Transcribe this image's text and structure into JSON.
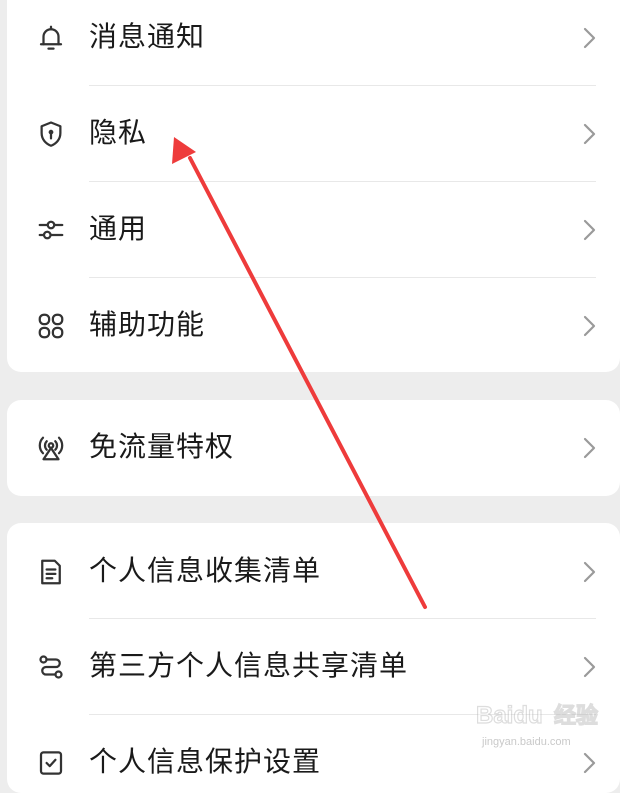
{
  "groups": [
    {
      "items": [
        {
          "label": "消息通知",
          "icon": "bell-icon"
        },
        {
          "label": "隐私",
          "icon": "shield-lock-icon"
        },
        {
          "label": "通用",
          "icon": "sliders-icon"
        },
        {
          "label": "辅助功能",
          "icon": "grid-icon"
        }
      ]
    },
    {
      "items": [
        {
          "label": "免流量特权",
          "icon": "signal-tower-icon"
        }
      ]
    },
    {
      "items": [
        {
          "label": "个人信息收集清单",
          "icon": "document-list-icon"
        },
        {
          "label": "第三方个人信息共享清单",
          "icon": "share-flow-icon"
        },
        {
          "label": "个人信息保护设置",
          "icon": "check-shield-icon"
        }
      ]
    }
  ],
  "annotation": {
    "type": "arrow",
    "color": "#ee3b3b",
    "points_to": "隐私"
  },
  "watermark": {
    "brand": "Baidu",
    "product": "经验",
    "site": "jingyan.baidu.com"
  },
  "colors": {
    "background": "#ededed",
    "card": "#ffffff",
    "text": "#1a1a1a",
    "icon": "#333333",
    "chevron": "#9a9a9a",
    "divider": "#e8e8e8"
  }
}
